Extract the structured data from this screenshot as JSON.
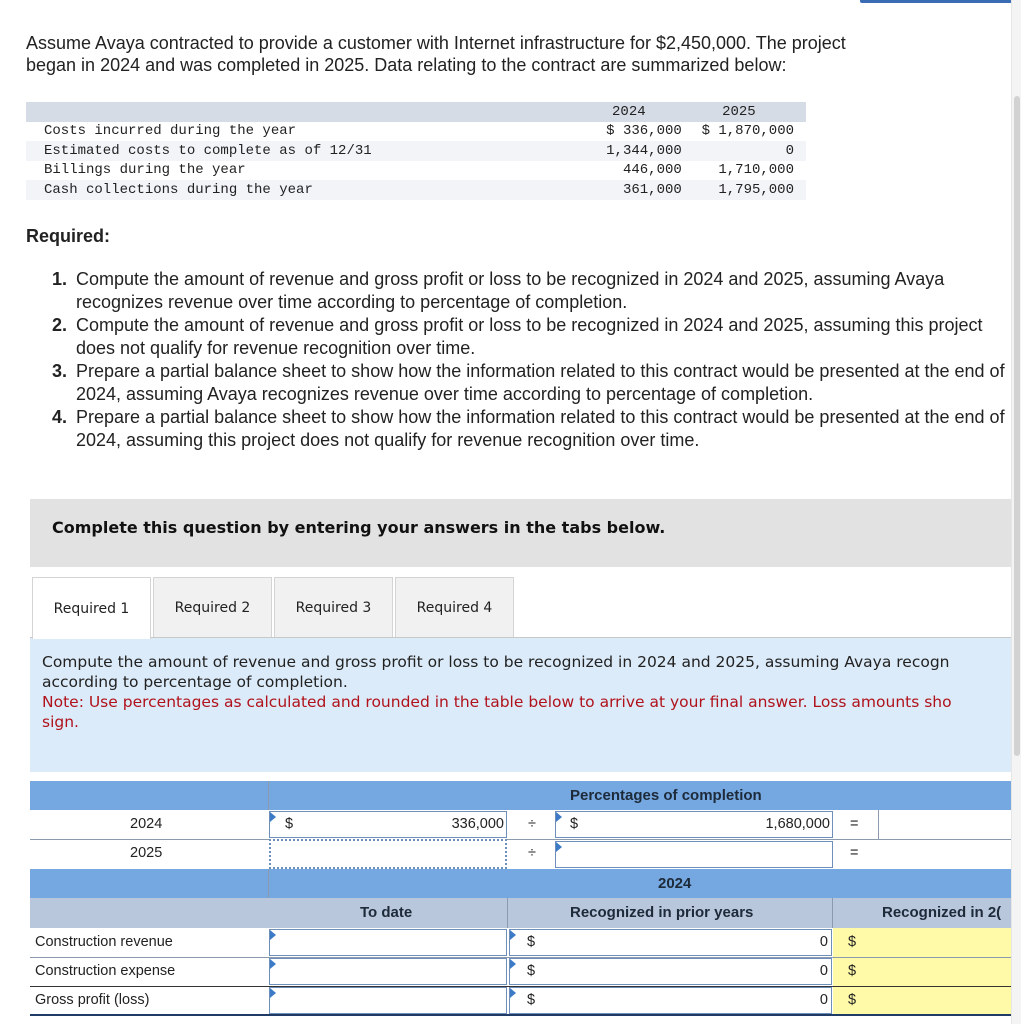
{
  "intro": {
    "line1": "Assume Avaya contracted to provide a customer with Internet infrastructure for $2,450,000. The project",
    "line2": "began in 2024 and was completed in 2025. Data relating to the contract are summarized below:"
  },
  "contract_table": {
    "headers": [
      "",
      "2024",
      "2025"
    ],
    "rows": [
      {
        "label": "Costs incurred during the year",
        "y2024": "$ 336,000",
        "y2025": "$ 1,870,000"
      },
      {
        "label": "Estimated costs to complete as of 12/31",
        "y2024": "1,344,000",
        "y2025": "0"
      },
      {
        "label": "Billings during the year",
        "y2024": "446,000",
        "y2025": "1,710,000"
      },
      {
        "label": "Cash collections during the year",
        "y2024": "361,000",
        "y2025": "1,795,000"
      }
    ]
  },
  "required": {
    "title": "Required:",
    "items": [
      {
        "num": "1.",
        "text": "Compute the amount of revenue and gross profit or loss to be recognized in 2024 and 2025, assuming Avaya recognizes revenue over time according to percentage of completion."
      },
      {
        "num": "2.",
        "text": "Compute the amount of revenue and gross profit or loss to be recognized in 2024 and 2025, assuming this project does not qualify for revenue recognition over time."
      },
      {
        "num": "3.",
        "text": "Prepare a partial balance sheet to show how the information related to this contract would be presented at the end of 2024, assuming Avaya recognizes revenue over time according to percentage of completion."
      },
      {
        "num": "4.",
        "text": "Prepare a partial balance sheet to show how the information related to this contract would be presented at the end of 2024, assuming this project does not qualify for revenue recognition over time."
      }
    ]
  },
  "instructions": "Complete this question by entering your answers in the tabs below.",
  "tabs": [
    {
      "label": "Required 1",
      "active": true
    },
    {
      "label": "Required 2",
      "active": false
    },
    {
      "label": "Required 3",
      "active": false
    },
    {
      "label": "Required 4",
      "active": false
    }
  ],
  "panel": {
    "prompt_line1": "Compute the amount of revenue and gross profit or loss to be recognized in 2024 and 2025, assuming Avaya recogn",
    "prompt_line2": "according to percentage of completion.",
    "note_line1": "Note: Use percentages as calculated and rounded in the table below to arrive at your final answer. Loss amounts sho",
    "note_line2": "sign."
  },
  "percent_table": {
    "header": "Percentages of completion",
    "rows": [
      {
        "year": "2024",
        "cost_currency": "$",
        "cost_value": "336,000",
        "div": "÷",
        "total_currency": "$",
        "total_value": "1,680,000",
        "eq": "=",
        "result": ""
      },
      {
        "year": "2025",
        "cost_currency": "",
        "cost_value": "",
        "div": "÷",
        "total_currency": "",
        "total_value": "",
        "eq": "=",
        "result": ""
      }
    ]
  },
  "recognition_table": {
    "year_header": "2024",
    "columns": [
      "To date",
      "Recognized in prior years",
      "Recognized in 2("
    ],
    "rows": [
      {
        "label": "Construction revenue",
        "to_date": "",
        "prior_currency": "$",
        "prior": "0",
        "current_currency": "$",
        "current": ""
      },
      {
        "label": "Construction expense",
        "to_date": "",
        "prior_currency": "$",
        "prior": "0",
        "current_currency": "$",
        "current": ""
      },
      {
        "label": "Gross profit (loss)",
        "to_date": "",
        "prior_currency": "$",
        "prior": "0",
        "current_currency": "$",
        "current": ""
      }
    ]
  },
  "colors": {
    "header_blue": "#75a8e0",
    "header_gray": "#b9c7dc",
    "panel_bg": "#dcebf9",
    "note_red": "#b0121b",
    "highlight_yellow": "#fffaa8"
  }
}
